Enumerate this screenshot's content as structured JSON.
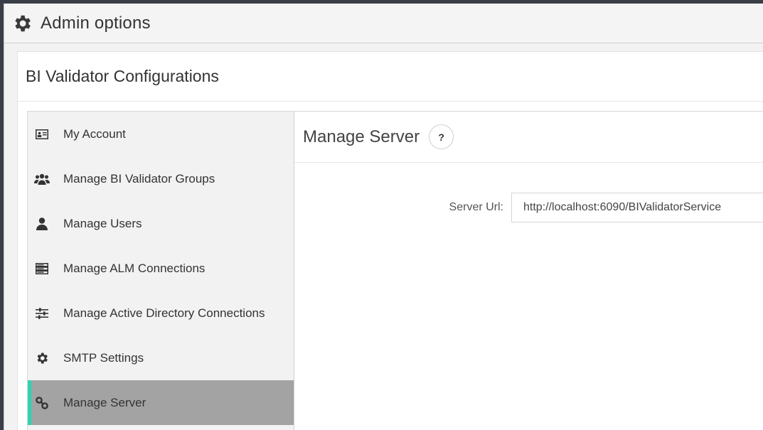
{
  "window": {
    "title": "Admin options",
    "icon": "gear-icon"
  },
  "panel": {
    "heading": "BI Validator Configurations"
  },
  "sidebar": {
    "items": [
      {
        "label": "My Account",
        "icon": "id-card-icon",
        "active": false
      },
      {
        "label": "Manage BI Validator Groups",
        "icon": "users-group-icon",
        "active": false
      },
      {
        "label": "Manage Users",
        "icon": "user-icon",
        "active": false
      },
      {
        "label": "Manage ALM Connections",
        "icon": "server-stack-icon",
        "active": false
      },
      {
        "label": "Manage Active Directory Connections",
        "icon": "sliders-icon",
        "active": false
      },
      {
        "label": "SMTP Settings",
        "icon": "gear-icon",
        "active": false
      },
      {
        "label": "Manage Server",
        "icon": "link-icon",
        "active": true
      }
    ]
  },
  "content": {
    "title": "Manage Server",
    "help_label": "?",
    "server_url": {
      "label": "Server Url:",
      "value": "http://localhost:6090/BIValidatorService"
    }
  },
  "colors": {
    "accent": "#2ed3b0",
    "active_bg": "#a3a3a3",
    "sidebar_bg": "#f2f2f2"
  }
}
